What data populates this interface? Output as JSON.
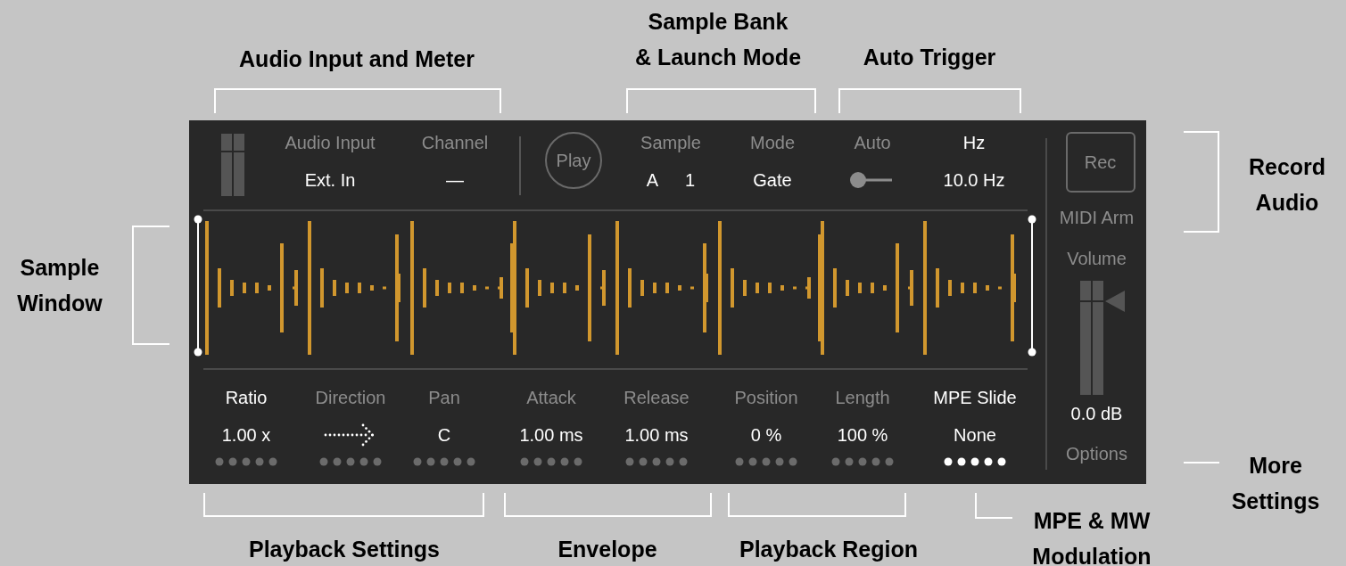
{
  "device": {
    "meter_label": "Audio Input",
    "input_value": "Ext. In",
    "channel_label": "Channel",
    "channel_value": "—",
    "play_button": "Play",
    "sample": {
      "label": "Sample",
      "bank": "A",
      "number": "1"
    },
    "mode": {
      "label": "Mode",
      "value": "Gate"
    },
    "auto": {
      "label": "Auto",
      "on": false
    },
    "rate": {
      "label": "Hz",
      "value": "10.0 Hz",
      "highlighted": true
    },
    "params": [
      {
        "label": "Ratio",
        "value": "1.00 x",
        "kind": "text",
        "highlighted": true,
        "modulated": false
      },
      {
        "label": "Direction",
        "kind": "arrow",
        "highlighted": false,
        "modulated": false
      },
      {
        "label": "Pan",
        "value": "C",
        "kind": "text",
        "highlighted": false,
        "modulated": false
      },
      {
        "label": "Attack",
        "value": "1.00 ms",
        "kind": "text",
        "highlighted": false,
        "modulated": false
      },
      {
        "label": "Release",
        "value": "1.00 ms",
        "kind": "text",
        "highlighted": false,
        "modulated": false
      },
      {
        "label": "Position",
        "value": "0 %",
        "kind": "text",
        "highlighted": false,
        "modulated": false
      },
      {
        "label": "Length",
        "value": "100 %",
        "kind": "text",
        "highlighted": false,
        "modulated": false
      },
      {
        "label": "MPE Slide",
        "value": "None",
        "kind": "text",
        "highlighted": true,
        "modulated": true
      }
    ],
    "rec_button": "Rec",
    "midi_arm": "MIDI Arm",
    "volume_label": "Volume",
    "volume_value": "0.0 dB",
    "options": "Options"
  },
  "annotations": [
    {
      "text": "Audio Input and Meter"
    },
    {
      "text": "Sample Bank\n& Launch Mode"
    },
    {
      "text": "Auto Trigger"
    },
    {
      "text": "Record\nAudio"
    },
    {
      "text": "Sample\nWindow"
    },
    {
      "text": "More\nSettings"
    },
    {
      "text": "Playback Settings"
    },
    {
      "text": "Envelope"
    },
    {
      "text": "Playback Region"
    },
    {
      "text": "MPE & MW\nModulation"
    }
  ]
}
